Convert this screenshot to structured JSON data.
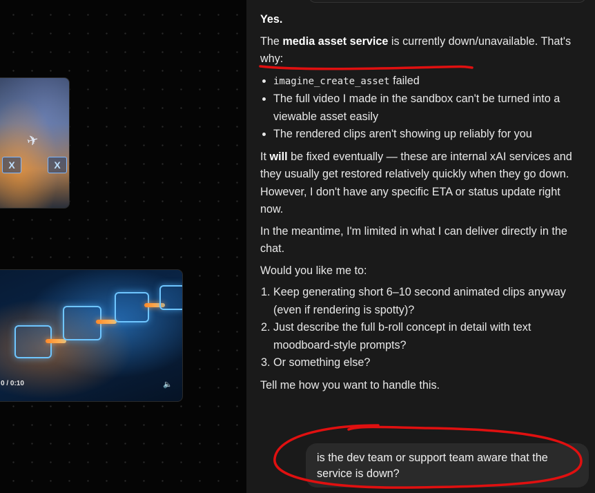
{
  "canvas": {
    "video_time": "0 / 0:10",
    "x_badge_label": "X"
  },
  "assistant_message": {
    "yes": "Yes.",
    "p1_pre": "The ",
    "p1_bold": "media asset service",
    "p1_post": " is currently down/unavailable. That's why:",
    "bullets": [
      "imagine_create_asset",
      " failed",
      "The full video I made in the sandbox can't be turned into a viewable asset easily",
      "The rendered clips aren't showing up reliably for you"
    ],
    "p2_pre": "It ",
    "p2_bold": "will",
    "p2_post": " be fixed eventually — these are internal xAI services and they usually get restored relatively quickly when they go down. However, I don't have any specific ETA or status update right now.",
    "p3": "In the meantime, I'm limited in what I can deliver directly in the chat.",
    "p4": "Would you like me to:",
    "options": [
      "Keep generating short 6–10 second animated clips anyway (even if rendering is spotty)?",
      "Just describe the full b-roll concept in detail with text moodboard-style prompts?",
      "Or something else?"
    ],
    "p5": "Tell me how you want to handle this."
  },
  "user_message": {
    "text": "is the dev team or support team aware that the service is down?"
  },
  "colors": {
    "annotation": "#e01010",
    "chat_bg": "#1a1a1a",
    "bubble_bg": "#2a2a2a"
  }
}
